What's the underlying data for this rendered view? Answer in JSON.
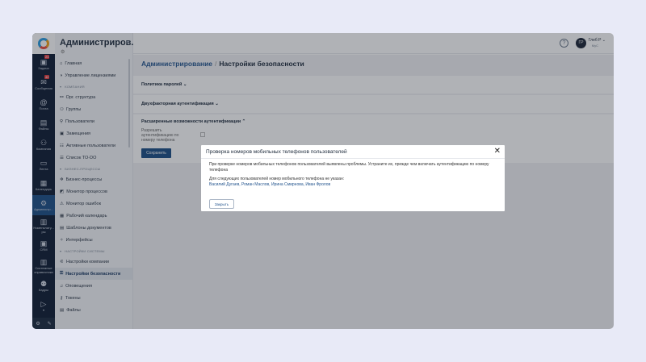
{
  "rail": {
    "items": [
      {
        "icon": "tasks-icon",
        "glyph": "▣",
        "label": "Задачи",
        "badge": "23"
      },
      {
        "icon": "messages-icon",
        "glyph": "✉",
        "label": "Сообщения",
        "badge": "42"
      },
      {
        "icon": "mail-icon",
        "glyph": "@",
        "label": "Почта"
      },
      {
        "icon": "files-icon",
        "glyph": "▤",
        "label": "Файлы"
      },
      {
        "icon": "company-icon",
        "glyph": "⚇",
        "label": "Компания"
      },
      {
        "icon": "feed-icon",
        "glyph": "▭",
        "label": "Лента"
      },
      {
        "icon": "calendar-icon",
        "glyph": "▦",
        "label": "Календарь"
      },
      {
        "icon": "admin-icon",
        "glyph": "⚙",
        "label": "Администр..."
      },
      {
        "icon": "nomenclature-icon",
        "glyph": "▥",
        "label": "Номенклату... ры"
      },
      {
        "icon": "crm-icon",
        "glyph": "▣",
        "label": "CRM"
      },
      {
        "icon": "directories-icon",
        "glyph": "▥",
        "label": "Системные справочники"
      },
      {
        "icon": "staff-icon",
        "glyph": "⚉",
        "label": "Кадры"
      },
      {
        "icon": "more-icon",
        "glyph": "▷",
        "label": "▾"
      }
    ]
  },
  "nav": {
    "title": "Администриров...",
    "items": [
      {
        "type": "item",
        "icon": "⌂",
        "label": "Главная"
      },
      {
        "type": "item",
        "icon": "◑",
        "label": "Управление лицензиями"
      },
      {
        "type": "section",
        "label": "КОМПАНИЯ"
      },
      {
        "type": "item",
        "icon": "⚯",
        "label": "Орг. структура"
      },
      {
        "type": "item",
        "icon": "⚇",
        "label": "Группы"
      },
      {
        "type": "item",
        "icon": "⚲",
        "label": "Пользователи"
      },
      {
        "type": "item",
        "icon": "▣",
        "label": "Замещения"
      },
      {
        "type": "item",
        "icon": "☷",
        "label": "Активные пользователи"
      },
      {
        "type": "item",
        "icon": "☰",
        "label": "Список TO-DO"
      },
      {
        "type": "section",
        "label": "БИЗНЕС-ПРОЦЕССЫ"
      },
      {
        "type": "item",
        "icon": "✲",
        "label": "Бизнес-процессы"
      },
      {
        "type": "item",
        "icon": "◩",
        "label": "Монитор процессов"
      },
      {
        "type": "item",
        "icon": "⚠",
        "label": "Монитор ошибок"
      },
      {
        "type": "item",
        "icon": "▦",
        "label": "Рабочий календарь"
      },
      {
        "type": "item",
        "icon": "▤",
        "label": "Шаблоны документов"
      },
      {
        "type": "item",
        "icon": "✧",
        "label": "Интерфейсы"
      },
      {
        "type": "section",
        "label": "НАСТРОЙКИ СИСТЕМЫ"
      },
      {
        "type": "item",
        "icon": "⚟",
        "label": "Настройки компании"
      },
      {
        "type": "item",
        "icon": "⚿",
        "label": "Настройки безопасности",
        "active": true
      },
      {
        "type": "item",
        "icon": "♫",
        "label": "Оповещения"
      },
      {
        "type": "item",
        "icon": "⚷",
        "label": "Токены"
      },
      {
        "type": "item",
        "icon": "▤",
        "label": "Файлы"
      }
    ]
  },
  "header": {
    "user_initials": "ГР",
    "user_name": "Глеб Р ⌄",
    "user_org": "МуС"
  },
  "main": {
    "breadcrumb_root": "Администрирование",
    "breadcrumb_sep": "/",
    "breadcrumb_current": "Настройки безопасности",
    "section1": "Политика паролей ⌄",
    "section2": "Двухфакторная аутентификация ⌄",
    "section3": "Расширенные возможности аутентификации ⌃",
    "phone_auth_label": "Разрешить аутентификацию по номеру телефона",
    "save": "Сохранить"
  },
  "modal": {
    "title": "Проверка номеров мобильных телефонов пользователей",
    "close_icon": "✕",
    "message": "При проверке номеров мобильных телефонов пользователей выявлены проблемы. Устраните их, прежде чем включать аутентификацию по номеру телефона",
    "missing_label": "Для следующих пользователей номер мобильного телефона не указан:",
    "users": "Василий Дугаев, Роман Маслов, Ирина Смирнова, Иван Фролов",
    "close_button": "Закрыть"
  }
}
